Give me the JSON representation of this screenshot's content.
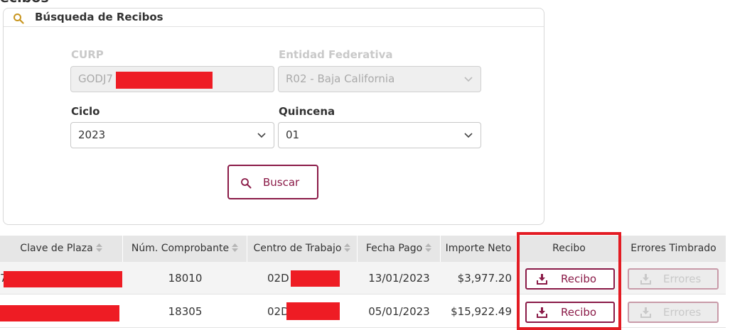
{
  "page": {
    "heading": "ecibos"
  },
  "search_card": {
    "title": "Búsqueda de Recibos",
    "icon": "search-icon",
    "curp": {
      "label": "CURP",
      "value": "GODJ7"
    },
    "entidad": {
      "label": "Entidad Federativa",
      "value": "R02 - Baja California"
    },
    "ciclo": {
      "label": "Ciclo",
      "value": "2023"
    },
    "quincena": {
      "label": "Quincena",
      "value": "01"
    },
    "search_button": "Buscar"
  },
  "table": {
    "headers": [
      "Clave de Plaza",
      "Núm. Comprobante",
      "Centro de Trabajo",
      "Fecha Pago",
      "Importe Neto",
      "Recibo",
      "Errores Timbrado"
    ],
    "rows": [
      {
        "clave_prefix": "7",
        "comprobante": "18010",
        "centro": "02D",
        "fecha": "13/01/2023",
        "importe": "$3,977.20",
        "recibo": "Recibo",
        "errores": "Errores"
      },
      {
        "clave_prefix": "",
        "comprobante": "18305",
        "centro": "02D",
        "fecha": "05/01/2023",
        "importe": "$15,922.49",
        "recibo": "Recibo",
        "errores": "Errores"
      }
    ]
  },
  "colors": {
    "accent": "#8a1a47",
    "redaction": "#ee1c24",
    "highlight": "#e31b23",
    "header_bg": "#e6e6e6"
  }
}
